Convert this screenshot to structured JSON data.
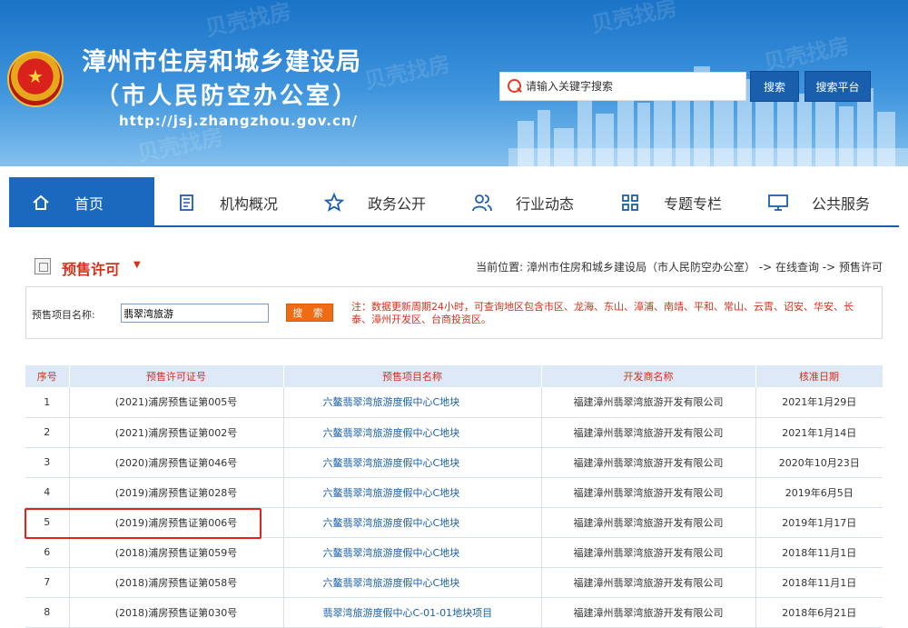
{
  "header": {
    "title_line1": "漳州市住房和城乡建设局",
    "title_line2": "（市人民防空办公室）",
    "url": "http://jsj.zhangzhou.gov.cn/",
    "search_placeholder": "请输入关键字搜索",
    "search_button": "搜索",
    "search_platform_button": "搜索平台",
    "watermark": "贝壳找房"
  },
  "nav": {
    "items": [
      {
        "label": "首页",
        "icon": "home-icon"
      },
      {
        "label": "机构概况",
        "icon": "document-icon"
      },
      {
        "label": "政务公开",
        "icon": "star-icon"
      },
      {
        "label": "行业动态",
        "icon": "people-icon"
      },
      {
        "label": "专题专栏",
        "icon": "grid-icon"
      },
      {
        "label": "公共服务",
        "icon": "monitor-icon"
      }
    ]
  },
  "section": {
    "title": "预售许可",
    "breadcrumb": "当前位置: 漳州市住房和城乡建设局（市人民防空办公室） -> 在线查询 -> 预售许可"
  },
  "filter": {
    "label": "预售项目名称:",
    "value": "翡翠湾旅游",
    "button": "搜 索",
    "note": "注：数据更新周期24小时，可查询地区包含市区、龙海、东山、漳浦、南靖、平和、常山、云霄、诏安、华安、长泰、漳州开发区、台商投资区。"
  },
  "table": {
    "headers": [
      "序号",
      "预售许可证号",
      "预售项目名称",
      "开发商名称",
      "核准日期"
    ],
    "rows": [
      {
        "no": "1",
        "cert": "(2021)浦房预售证第005号",
        "project": "六鳌翡翠湾旅游度假中心C地块",
        "developer": "福建漳州翡翠湾旅游开发有限公司",
        "date": "2021年1月29日"
      },
      {
        "no": "2",
        "cert": "(2021)浦房预售证第002号",
        "project": "六鳌翡翠湾旅游度假中心C地块",
        "developer": "福建漳州翡翠湾旅游开发有限公司",
        "date": "2021年1月14日"
      },
      {
        "no": "3",
        "cert": "(2020)浦房预售证第046号",
        "project": "六鳌翡翠湾旅游度假中心C地块",
        "developer": "福建漳州翡翠湾旅游开发有限公司",
        "date": "2020年10月23日"
      },
      {
        "no": "4",
        "cert": "(2019)浦房预售证第028号",
        "project": "六鳌翡翠湾旅游度假中心C地块",
        "developer": "福建漳州翡翠湾旅游开发有限公司",
        "date": "2019年6月5日"
      },
      {
        "no": "5",
        "cert": "(2019)浦房预售证第006号",
        "project": "六鳌翡翠湾旅游度假中心C地块",
        "developer": "福建漳州翡翠湾旅游开发有限公司",
        "date": "2019年1月17日"
      },
      {
        "no": "6",
        "cert": "(2018)浦房预售证第059号",
        "project": "六鳌翡翠湾旅游度假中心C地块",
        "developer": "福建漳州翡翠湾旅游开发有限公司",
        "date": "2018年11月1日"
      },
      {
        "no": "7",
        "cert": "(2018)浦房预售证第058号",
        "project": "六鳌翡翠湾旅游度假中心C地块",
        "developer": "福建漳州翡翠湾旅游开发有限公司",
        "date": "2018年11月1日"
      },
      {
        "no": "8",
        "cert": "(2018)浦房预售证第030号",
        "project": "翡翠湾旅游度假中心C-01-01地块项目",
        "developer": "福建漳州翡翠湾旅游开发有限公司",
        "date": "2018年6月21日"
      }
    ]
  },
  "colors": {
    "primary": "#1a5fae",
    "accent": "#d4321c",
    "highlight_box": "#e0241c",
    "search_button": "#f06b13"
  }
}
